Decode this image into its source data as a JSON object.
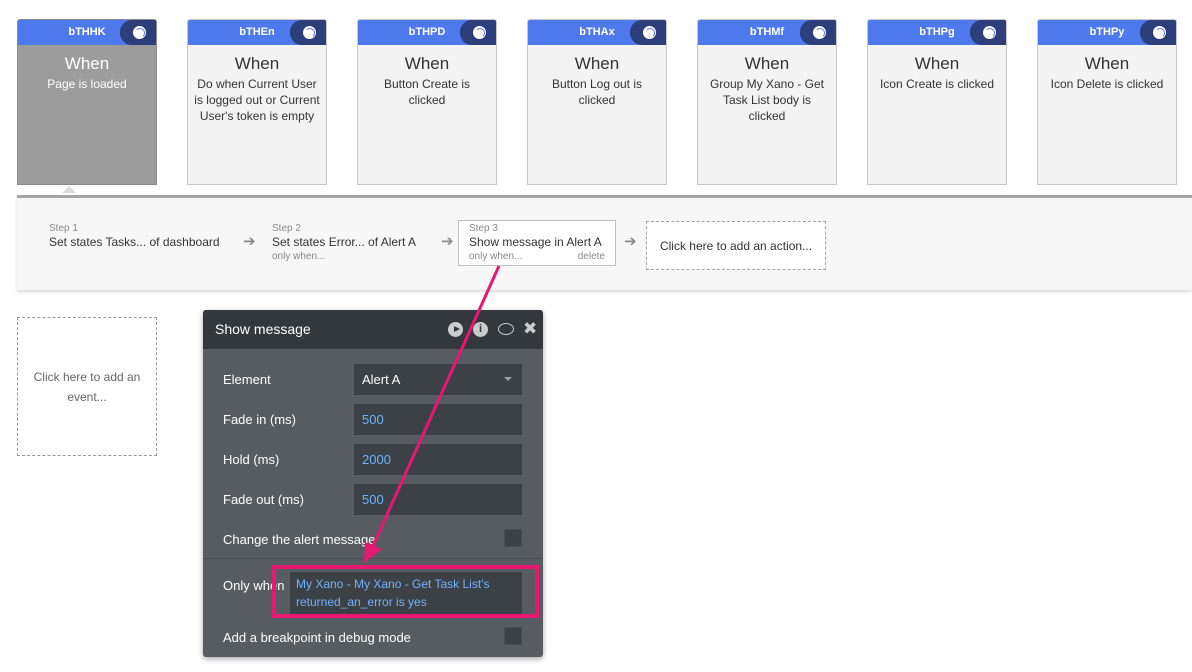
{
  "events": [
    {
      "id": "bTHHK",
      "when": "When",
      "desc": "Page is loaded",
      "selected": true
    },
    {
      "id": "bTHEn",
      "when": "When",
      "desc": "Do when Current User is logged out or Current User's token is empty"
    },
    {
      "id": "bTHPD",
      "when": "When",
      "desc": "Button Create is clicked"
    },
    {
      "id": "bTHAx",
      "when": "When",
      "desc": "Button Log out is clicked"
    },
    {
      "id": "bTHMf",
      "when": "When",
      "desc": "Group My Xano - Get Task List body is clicked"
    },
    {
      "id": "bTHPg",
      "when": "When",
      "desc": "Icon Create is clicked"
    },
    {
      "id": "bTHPy",
      "when": "When",
      "desc": "Icon Delete is clicked"
    }
  ],
  "steps": {
    "step1": {
      "num": "Step 1",
      "title": "Set states Tasks... of dashboard"
    },
    "step2": {
      "num": "Step 2",
      "title": "Set states Error... of Alert A",
      "sub": "only when..."
    },
    "step3": {
      "num": "Step 3",
      "title": "Show message in Alert A",
      "sub": "only when...",
      "delete": "delete"
    },
    "add_action": "Click here to add an action..."
  },
  "add_event": "Click here to add an event...",
  "panel": {
    "title": "Show message",
    "info_glyph": "i",
    "close_glyph": "✖",
    "element_label": "Element",
    "element_value": "Alert A",
    "fade_in_label": "Fade in (ms)",
    "fade_in_value": "500",
    "hold_label": "Hold (ms)",
    "hold_value": "2000",
    "fade_out_label": "Fade out (ms)",
    "fade_out_value": "500",
    "change_msg_label": "Change the alert message",
    "only_when_label": "Only when",
    "only_when_value": "My Xano - My Xano - Get Task List's returned_an_error is yes",
    "breakpoint_label": "Add a breakpoint in debug mode"
  },
  "arrow_glyph": "➔",
  "colors": {
    "accent": "#4e79ec",
    "highlight": "#e8176f",
    "value_blue": "#6fb0ff"
  }
}
